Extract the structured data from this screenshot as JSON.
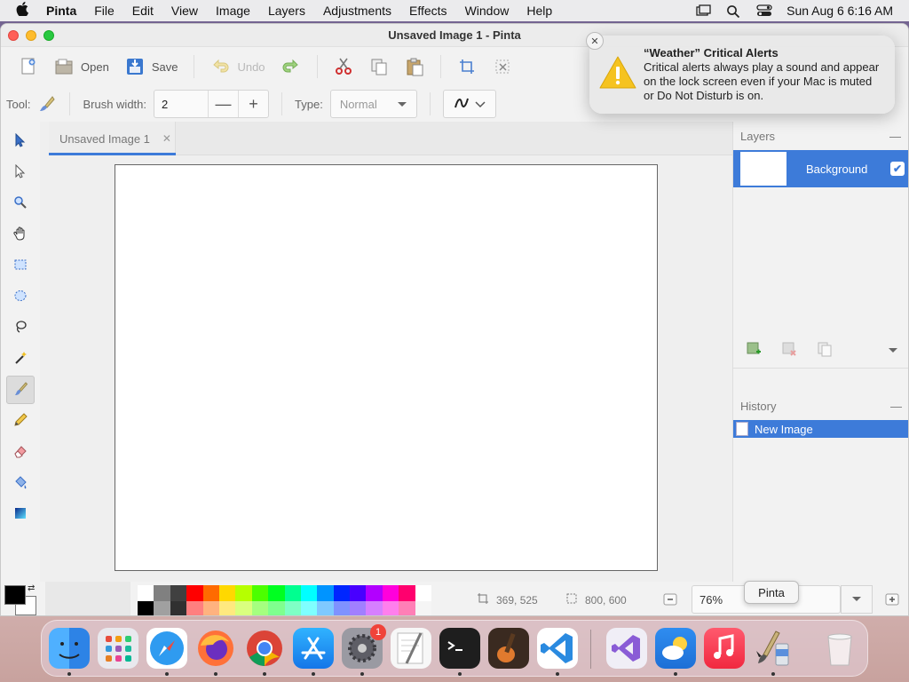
{
  "menubar": {
    "app_name": "Pinta",
    "items": [
      "File",
      "Edit",
      "View",
      "Image",
      "Layers",
      "Adjustments",
      "Effects",
      "Window",
      "Help"
    ],
    "clock": "Sun Aug 6  6:16 AM"
  },
  "window": {
    "title": "Unsaved Image 1 - Pinta"
  },
  "toolbar": {
    "open_label": "Open",
    "save_label": "Save",
    "undo_label": "Undo"
  },
  "options": {
    "tool_label": "Tool:",
    "brush_width_label": "Brush width:",
    "brush_width_value": "2",
    "type_label": "Type:",
    "type_value": "Normal"
  },
  "document": {
    "tab_title": "Unsaved Image 1"
  },
  "layers": {
    "header": "Layers",
    "items": [
      {
        "name": "Background",
        "visible": true
      }
    ]
  },
  "history": {
    "header": "History",
    "items": [
      "New Image"
    ]
  },
  "status": {
    "cursor_position": "369, 525",
    "image_size": "800, 600",
    "zoom": "76%"
  },
  "tooltip": {
    "text": "Pinta"
  },
  "notification": {
    "title": "“Weather” Critical Alerts",
    "body": "Critical alerts always play a sound and appear on the lock screen even if your Mac is muted or Do Not Disturb is on."
  },
  "palette": {
    "top": [
      "#ffffff",
      "#808080",
      "#404040",
      "#ff0000",
      "#ff6a00",
      "#ffd800",
      "#b6ff00",
      "#4cff00",
      "#00ff21",
      "#00ff90",
      "#00ffff",
      "#0094ff",
      "#0026ff",
      "#4800ff",
      "#b200ff",
      "#ff00dc",
      "#ff006e",
      "#ffffff"
    ],
    "bottom": [
      "#000000",
      "#a0a0a0",
      "#303030",
      "#ff7f7f",
      "#ffb27f",
      "#ffe97f",
      "#daff7f",
      "#a5ff7f",
      "#7fff8e",
      "#7fffc5",
      "#7fffff",
      "#7fc9ff",
      "#7f92ff",
      "#a17fff",
      "#d67fff",
      "#ff7fed",
      "#ff7fb6",
      "#f5f5f5"
    ]
  },
  "dock": {
    "apps": [
      "finder",
      "launchpad",
      "safari",
      "firefox",
      "chrome",
      "app-store",
      "system-settings",
      "textedit",
      "terminal",
      "garageband",
      "vscode",
      "visual-studio",
      "weather",
      "music",
      "pinta",
      "trash"
    ],
    "settings_badge": "1"
  },
  "colors": {
    "accent": "#3d7bd9"
  }
}
